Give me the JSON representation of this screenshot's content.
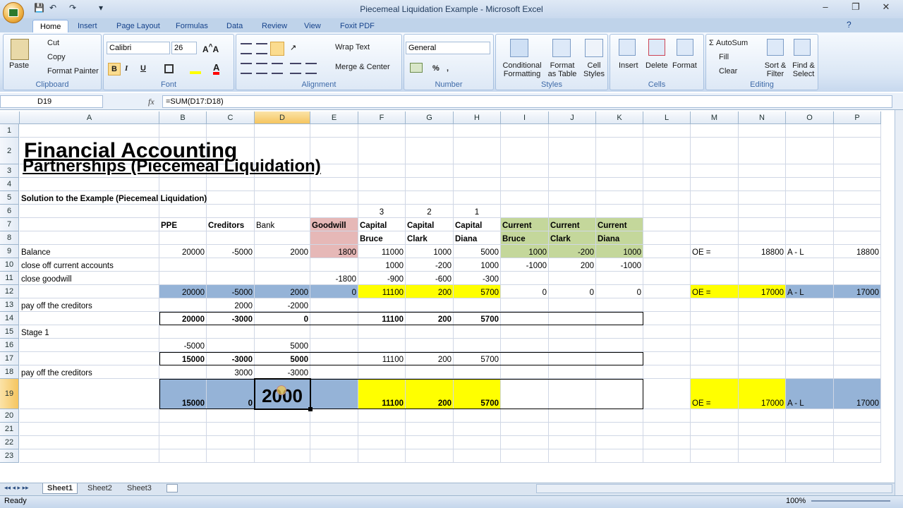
{
  "window": {
    "title": "Piecemeal Liquidation Example - Microsoft Excel",
    "minimize": "–",
    "restore": "❐",
    "close": "✕"
  },
  "qat": {
    "save": "💾",
    "undo": "↶",
    "redo": "↷",
    "more": "▾"
  },
  "tabs": [
    "Home",
    "Insert",
    "Page Layout",
    "Formulas",
    "Data",
    "Review",
    "View",
    "Foxit PDF"
  ],
  "ribbon": {
    "clipboard": {
      "label": "Clipboard",
      "paste": "Paste",
      "cut": "Cut",
      "copy": "Copy",
      "format_painter": "Format Painter"
    },
    "font": {
      "label": "Font",
      "name": "Calibri",
      "size": "26",
      "bold": "B",
      "italic": "I",
      "underline": "U"
    },
    "alignment": {
      "label": "Alignment",
      "wrap": "Wrap Text",
      "merge": "Merge & Center"
    },
    "number": {
      "label": "Number",
      "format": "General",
      "percent": "%",
      "comma": ","
    },
    "styles": {
      "label": "Styles",
      "conditional": "Conditional Formatting",
      "as_table": "Format as Table",
      "cell_styles": "Cell Styles"
    },
    "cells": {
      "label": "Cells",
      "insert": "Insert",
      "delete": "Delete",
      "format": "Format"
    },
    "editing": {
      "label": "Editing",
      "autosum": "AutoSum",
      "fill": "Fill",
      "clear": "Clear",
      "sort": "Sort & Filter",
      "find": "Find & Select"
    }
  },
  "formula_bar": {
    "name_box": "D19",
    "fx": "fx",
    "formula": "=SUM(D17:D18)"
  },
  "columns": [
    "A",
    "B",
    "C",
    "D",
    "E",
    "F",
    "G",
    "H",
    "I",
    "J",
    "K",
    "L",
    "M",
    "N",
    "O",
    "P"
  ],
  "rows": [
    "1",
    "2",
    "3",
    "4",
    "5",
    "6",
    "7",
    "8",
    "9",
    "10",
    "11",
    "12",
    "13",
    "14",
    "15",
    "16",
    "17",
    "18",
    "19",
    "20",
    "21",
    "22",
    "23"
  ],
  "sheet": {
    "title1": "Financial Accounting",
    "title2": "Partnerships (Piecemeal Liquidation)",
    "subtitle": "Solution to the Example (Piecemeal Liquidation)",
    "order": {
      "F": "3",
      "G": "2",
      "H": "1"
    },
    "headers": {
      "B": "PPE",
      "C": "Creditors",
      "D": "Bank",
      "E": "Goodwill",
      "F7": "Capital",
      "F8": "Bruce",
      "G7": "Capital",
      "G8": "Clark",
      "H7": "Capital",
      "H8": "Diana",
      "I7": "Current",
      "I8": "Bruce",
      "J7": "Current",
      "J8": "Clark",
      "K7": "Current",
      "K8": "Diana"
    },
    "r9": {
      "A": "Balance",
      "B": "20000",
      "C": "-5000",
      "D": "2000",
      "E": "1800",
      "F": "11000",
      "G": "1000",
      "H": "5000",
      "I": "1000",
      "J": "-200",
      "K": "1000",
      "M": "OE =",
      "N": "18800",
      "O": "A - L",
      "P": "18800"
    },
    "r10": {
      "A": "close off current accounts",
      "F": "1000",
      "G": "-200",
      "H": "1000",
      "I": "-1000",
      "J": "200",
      "K": "-1000"
    },
    "r11": {
      "A": "close goodwill",
      "E": "-1800",
      "F": "-900",
      "G": "-600",
      "H": "-300"
    },
    "r12": {
      "B": "20000",
      "C": "-5000",
      "D": "2000",
      "E": "0",
      "F": "11100",
      "G": "200",
      "H": "5700",
      "I": "0",
      "J": "0",
      "K": "0",
      "M": "OE =",
      "N": "17000",
      "O": "A - L",
      "P": "17000"
    },
    "r13": {
      "A": "pay off the creditors",
      "C": "2000",
      "D": "-2000"
    },
    "r14": {
      "B": "20000",
      "C": "-3000",
      "D": "0",
      "F": "11100",
      "G": "200",
      "H": "5700"
    },
    "r15": {
      "A": "Stage 1"
    },
    "r16": {
      "B": "-5000",
      "D": "5000"
    },
    "r17": {
      "B": "15000",
      "C": "-3000",
      "D": "5000",
      "F": "11100",
      "G": "200",
      "H": "5700"
    },
    "r18": {
      "A": "pay off the creditors",
      "C": "3000",
      "D": "-3000"
    },
    "r19": {
      "B": "15000",
      "C": "0",
      "D": "2000",
      "F": "11100",
      "G": "200",
      "H": "5700",
      "M": "OE =",
      "N": "17000",
      "O": "A - L",
      "P": "17000"
    }
  },
  "sheet_tabs": [
    "Sheet1",
    "Sheet2",
    "Sheet3"
  ],
  "status": {
    "ready": "Ready",
    "zoom": "100%"
  },
  "colors": {
    "blue": "#95b3d7",
    "yellow": "#ffff00",
    "green": "#c4d79b",
    "pink": "#e6b8b7"
  }
}
